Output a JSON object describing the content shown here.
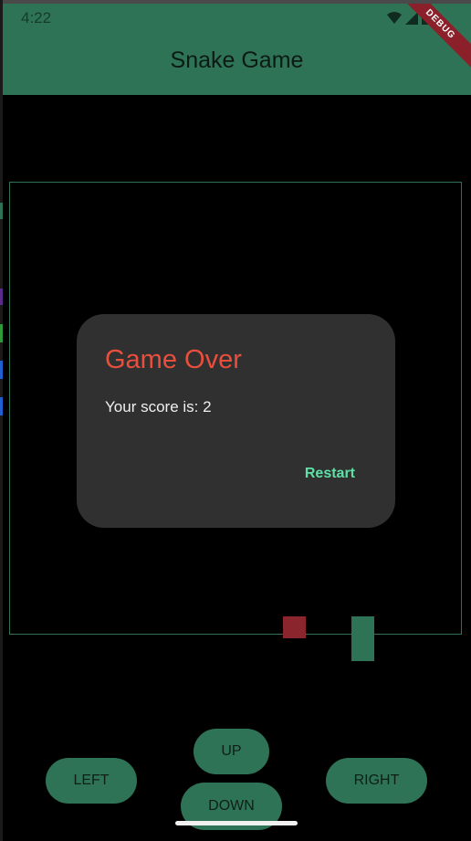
{
  "status": {
    "time": "4:22",
    "wifi_icon": "wifi-icon",
    "signal_icon": "signal-icon"
  },
  "appbar": {
    "title": "Snake Game",
    "debug_label": "DEBUG"
  },
  "colors": {
    "accent": "#2f7356",
    "food": "#8a252d",
    "dialog_title": "#ea4e3c",
    "action": "#5fe0a7"
  },
  "dialog": {
    "title": "Game Over",
    "message": "Your score is: 2",
    "restart_label": "Restart"
  },
  "controls": {
    "up": "UP",
    "left": "LEFT",
    "right": "RIGHT",
    "down": "DOWN"
  }
}
